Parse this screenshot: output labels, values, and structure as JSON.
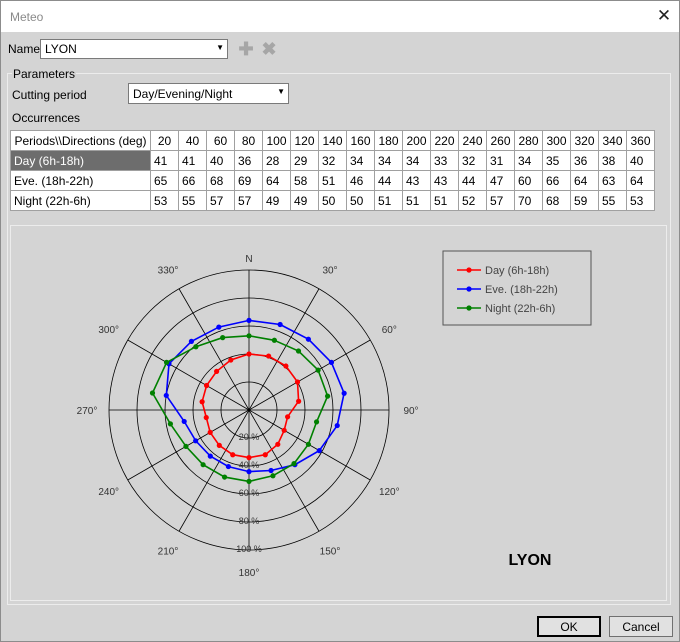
{
  "window": {
    "title": "Meteo",
    "close_icon": "close-icon"
  },
  "name_field": {
    "label": "Name",
    "value": "LYON"
  },
  "toolbar": {
    "add_icon": "plus-icon",
    "delete_icon": "cross-icon"
  },
  "parameters": {
    "label": "Parameters",
    "cutting_period_label": "Cutting period",
    "cutting_period_value": "Day/Evening/Night",
    "occurrences_label": "Occurrences"
  },
  "table": {
    "corner": "Periods\\\\Directions (deg)",
    "directions": [
      "20",
      "40",
      "60",
      "80",
      "100",
      "120",
      "140",
      "160",
      "180",
      "200",
      "220",
      "240",
      "260",
      "280",
      "300",
      "320",
      "340",
      "360"
    ],
    "rows": [
      {
        "label": "Day (6h-18h)",
        "values": [
          "41",
          "41",
          "40",
          "36",
          "28",
          "29",
          "32",
          "34",
          "34",
          "34",
          "33",
          "32",
          "31",
          "34",
          "35",
          "36",
          "38",
          "40"
        ]
      },
      {
        "label": "Eve. (18h-22h)",
        "values": [
          "65",
          "66",
          "68",
          "69",
          "64",
          "58",
          "51",
          "46",
          "44",
          "43",
          "43",
          "44",
          "47",
          "60",
          "66",
          "64",
          "63",
          "64"
        ]
      },
      {
        "label": "Night (22h-6h)",
        "values": [
          "53",
          "55",
          "57",
          "57",
          "49",
          "49",
          "50",
          "50",
          "51",
          "51",
          "51",
          "52",
          "57",
          "70",
          "68",
          "59",
          "55",
          "53"
        ]
      }
    ]
  },
  "chart_data": {
    "type": "polar-line",
    "title": "LYON",
    "compass_north": "N",
    "angle_labels": [
      "330°",
      "30°",
      "60°",
      "300°",
      "90°",
      "270°",
      "120°",
      "240°",
      "150°",
      "210°",
      "180°"
    ],
    "radial_labels": [
      "20 %",
      "40 %",
      "60 %",
      "80 %",
      "100 %"
    ],
    "radial_max": 100,
    "directions": [
      20,
      40,
      60,
      80,
      100,
      120,
      140,
      160,
      180,
      200,
      220,
      240,
      260,
      280,
      300,
      320,
      340,
      360
    ],
    "legend_position": "top-right",
    "series": [
      {
        "name": "Day (6h-18h)",
        "color": "#ff0000",
        "values": [
          41,
          41,
          40,
          36,
          28,
          29,
          32,
          34,
          34,
          34,
          33,
          32,
          31,
          34,
          35,
          36,
          38,
          40
        ]
      },
      {
        "name": "Eve. (18h-22h)",
        "color": "#0000ff",
        "values": [
          65,
          66,
          68,
          69,
          64,
          58,
          51,
          46,
          44,
          43,
          43,
          44,
          47,
          60,
          66,
          64,
          63,
          64
        ]
      },
      {
        "name": "Night (22h-6h)",
        "color": "#008000",
        "values": [
          53,
          55,
          57,
          57,
          49,
          49,
          50,
          50,
          51,
          51,
          51,
          52,
          57,
          70,
          68,
          59,
          55,
          53
        ]
      }
    ]
  },
  "buttons": {
    "ok": "OK",
    "cancel": "Cancel"
  }
}
